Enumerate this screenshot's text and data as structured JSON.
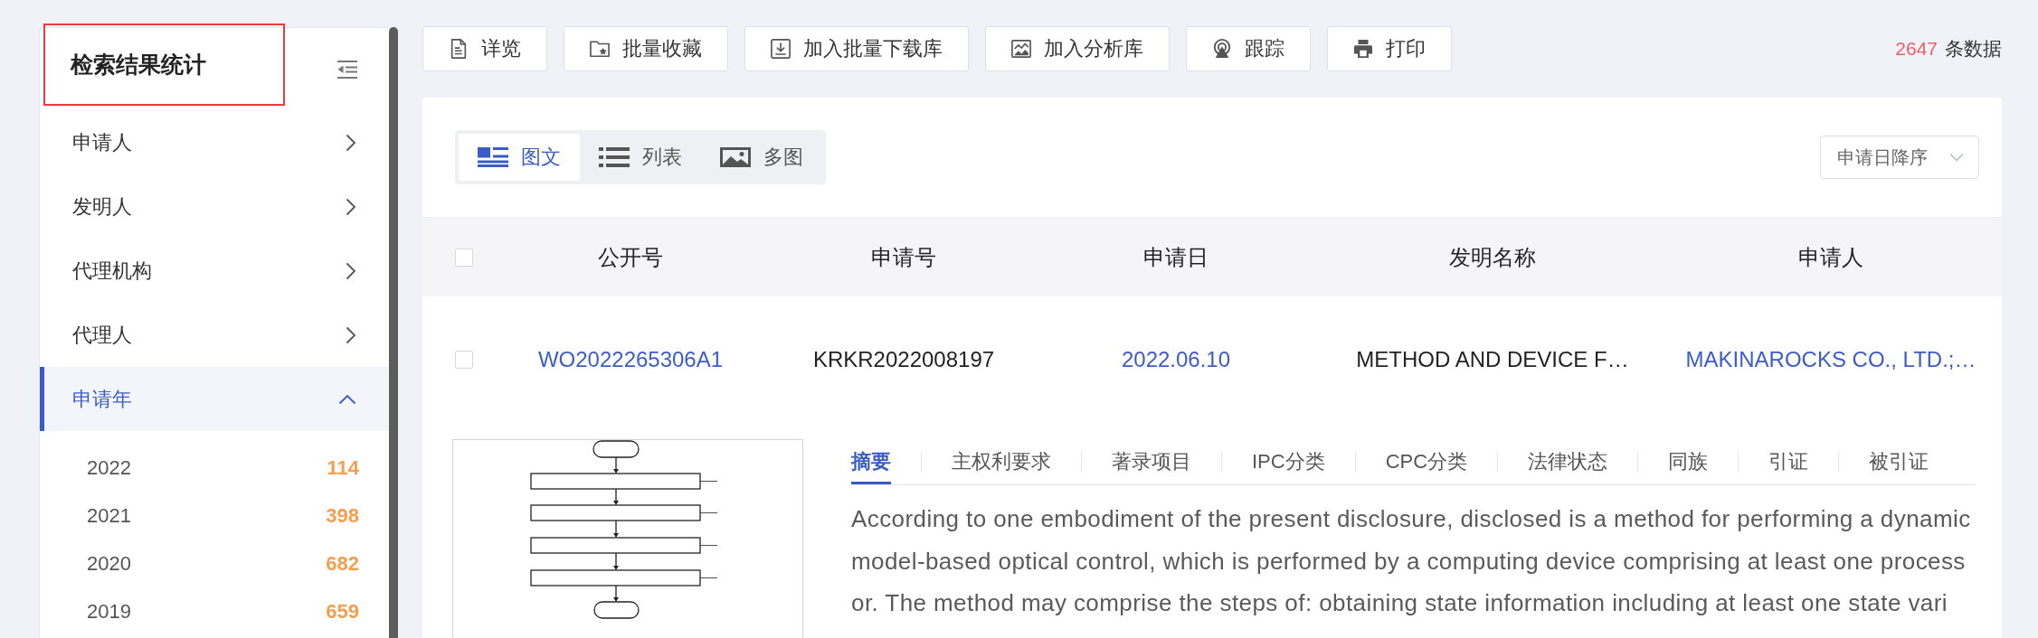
{
  "sidebar": {
    "title": "检索结果统计",
    "title_highlighted": true,
    "items": [
      {
        "label": "申请人",
        "selected": false,
        "expanded": false
      },
      {
        "label": "发明人",
        "selected": false,
        "expanded": false
      },
      {
        "label": "代理机构",
        "selected": false,
        "expanded": false
      },
      {
        "label": "代理人",
        "selected": false,
        "expanded": false
      },
      {
        "label": "申请年",
        "selected": true,
        "expanded": true,
        "children": [
          {
            "label": "2022",
            "count": "114"
          },
          {
            "label": "2021",
            "count": "398"
          },
          {
            "label": "2020",
            "count": "682"
          },
          {
            "label": "2019",
            "count": "659"
          }
        ]
      }
    ]
  },
  "toolbar": {
    "buttons": [
      "详览",
      "批量收藏",
      "加入批量下载库",
      "加入分析库",
      "跟踪",
      "打印"
    ],
    "total": {
      "count": "2647",
      "label": "条数据"
    }
  },
  "views": [
    {
      "label": "图文",
      "selected": true
    },
    {
      "label": "列表",
      "selected": false
    },
    {
      "label": "多图",
      "selected": false
    }
  ],
  "sort": {
    "value": "申请日降序"
  },
  "table": {
    "select_all_checked": false,
    "columns": [
      "公开号",
      "申请号",
      "申请日",
      "发明名称",
      "申请人"
    ],
    "rows": [
      {
        "checked": false,
        "cells": [
          {
            "text": "WO2022265306A1",
            "kind": "link"
          },
          {
            "text": "KRKR2022008197",
            "kind": "text"
          },
          {
            "text": "2022.06.10",
            "kind": "link"
          },
          {
            "text": "METHOD AND DEVICE F…",
            "kind": "text"
          },
          {
            "text": "MAKINAROCKS CO., LTD.;…",
            "kind": "link"
          }
        ]
      }
    ]
  },
  "detail": {
    "tabs": [
      {
        "label": "摘要",
        "selected": true
      },
      {
        "label": "主权利要求",
        "selected": false
      },
      {
        "label": "著录项目",
        "selected": false
      },
      {
        "label": "IPC分类",
        "selected": false
      },
      {
        "label": "CPC分类",
        "selected": false
      },
      {
        "label": "法律状态",
        "selected": false
      },
      {
        "label": "同族",
        "selected": false
      },
      {
        "label": "引证",
        "selected": false
      },
      {
        "label": "被引证",
        "selected": false
      }
    ],
    "abstract": "According to one embodiment of the present disclosure, disclosed is a method for performing a dynamic model-based optical control, which is performed by a computing device comprising at least one processor. The method may comprise the steps of: obtaining state information including at least one state vari"
  }
}
